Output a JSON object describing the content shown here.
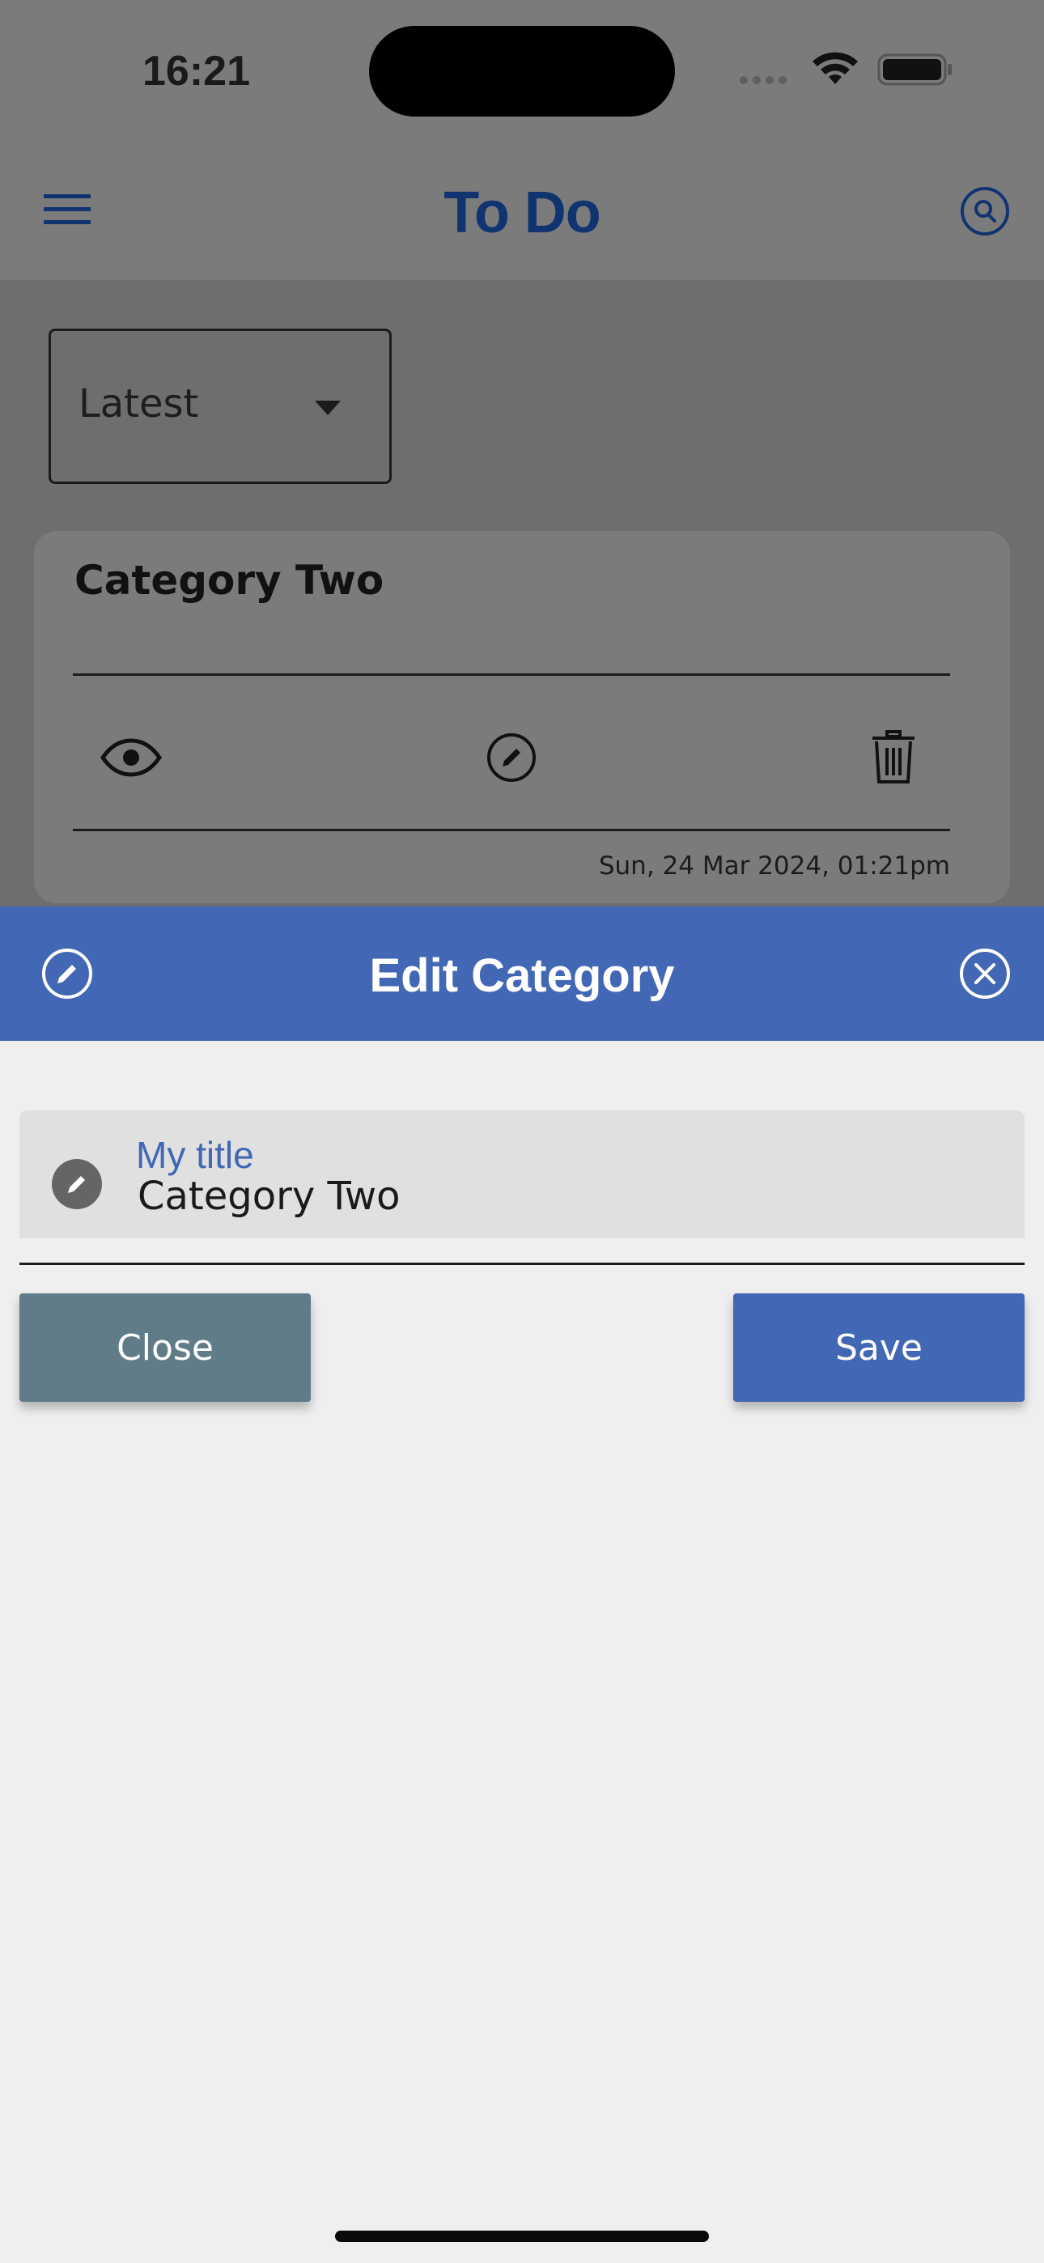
{
  "status_bar": {
    "time": "16:21"
  },
  "app_bar": {
    "title": "To Do"
  },
  "sort": {
    "selected": "Latest"
  },
  "card": {
    "title": "Category Two",
    "date": "Sun, 24 Mar 2024, 01:21pm",
    "actions": [
      "eye-icon",
      "edit-icon",
      "trash-icon"
    ]
  },
  "dialog": {
    "title": "Edit Category",
    "field": {
      "label": "My title",
      "value": "Category Two"
    },
    "close_label": "Close",
    "save_label": "Save"
  },
  "colors": {
    "accent": "#4267b4",
    "app_title": "#0f3470",
    "close_button": "#5f7c88",
    "overlay": "#7b7b7b"
  }
}
